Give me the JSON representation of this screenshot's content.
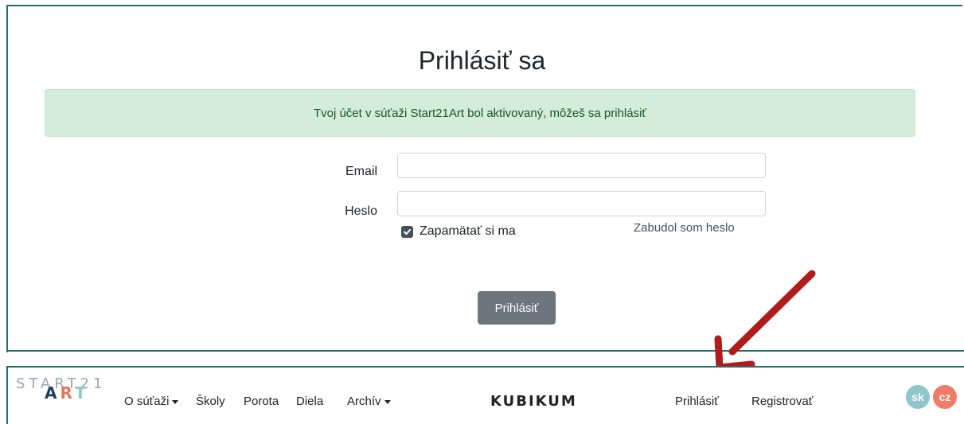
{
  "login": {
    "title": "Prihlásiť sa",
    "alert": "Tvoj účet v súťaži Start21Art bol aktivovaný, môžeš sa prihlásiť",
    "email_label": "Email",
    "email_value": "",
    "password_label": "Heslo",
    "password_value": "",
    "remember_label": "Zapamätať si ma",
    "remember_checked": true,
    "forgot_link": "Zabudol som heslo",
    "submit_label": "Prihlásiť"
  },
  "navbar": {
    "logo_top": "START21",
    "logo_art": [
      "A",
      "R",
      "T"
    ],
    "items": [
      {
        "label": "O súťaži",
        "dropdown": true
      },
      {
        "label": "Školy",
        "dropdown": false
      },
      {
        "label": "Porota",
        "dropdown": false
      },
      {
        "label": "Diela",
        "dropdown": false
      },
      {
        "label": "Archív",
        "dropdown": true
      }
    ],
    "brand": "KUBIKUM",
    "login_link": "Prihlásiť",
    "register_link": "Registrovať",
    "languages": [
      "sk",
      "cz"
    ]
  },
  "colors": {
    "border_teal": "#1f6f6a",
    "alert_bg": "#d4edda",
    "alert_text": "#155724",
    "button_gray": "#6c757d",
    "arrow_red": "#b01c1c",
    "lang_sk": "#8fc6c9",
    "lang_cz": "#f07b67"
  },
  "icons": {
    "checkbox": "check-icon",
    "caret": "caret-down-icon",
    "annotation": "red-arrow-icon"
  }
}
